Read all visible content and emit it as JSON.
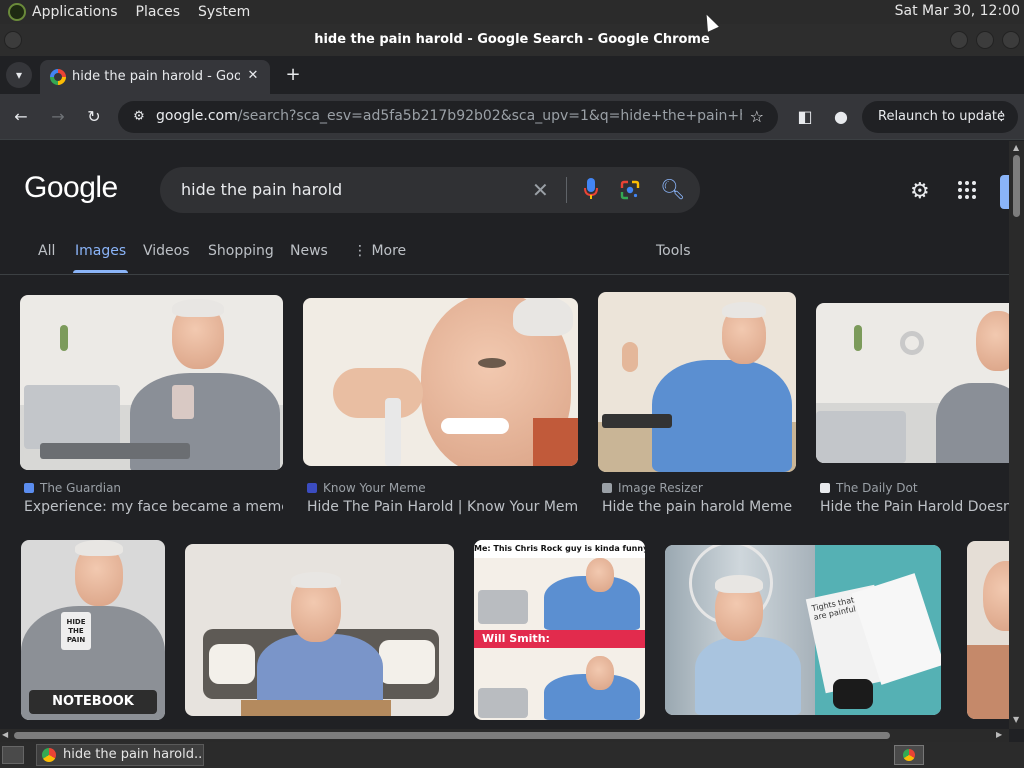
{
  "top_panel": {
    "menus": [
      "Applications",
      "Places",
      "System"
    ],
    "clock": "Sat Mar 30, 12:00"
  },
  "window": {
    "title": "hide the pain harold - Google Search - Google Chrome"
  },
  "tab": {
    "title": "hide the pain harold - Google Search",
    "close": "✕"
  },
  "toolbar": {
    "url_host": "google.com",
    "url_rest": "/search?sca_esv=ad5fa5b217b92b02&sca_upv=1&q=hide+the+pain+harold&uds...",
    "relaunch_label": "Relaunch to update"
  },
  "google": {
    "logo": "Google",
    "query": "hide the pain harold",
    "tabs": [
      "All",
      "Images",
      "Videos",
      "Shopping",
      "News",
      "More"
    ],
    "tools": "Tools"
  },
  "results_row1": [
    {
      "source": "The Guardian",
      "title": "Experience: my face became a meme ...",
      "icon_color": "#5b8def"
    },
    {
      "source": "Know Your Meme",
      "title": "Hide The Pain Harold | Know Your Meme",
      "icon_color": "#3b4cc0"
    },
    {
      "source": "Image Resizer",
      "title": "Hide the pain harold Meme ...",
      "icon_color": "#9aa0a6"
    },
    {
      "source": "The Daily Dot",
      "title": "Hide the Pain Harold Doesn't W",
      "icon_color": "#e8eaed"
    }
  ],
  "results_row2": {
    "notebook_label": "NOTEBOOK",
    "mug_text": "HIDE THE PAIN",
    "meme_top": "Me: This Chris Rock guy is kinda funny",
    "meme_bottom": "Will Smith:",
    "book_text": "Tights that rip are painful"
  },
  "taskbar": {
    "item": "hide the pain harold..."
  },
  "colors": {
    "accent": "#8ab4f8",
    "page_bg": "#202124",
    "surface": "#303134"
  }
}
